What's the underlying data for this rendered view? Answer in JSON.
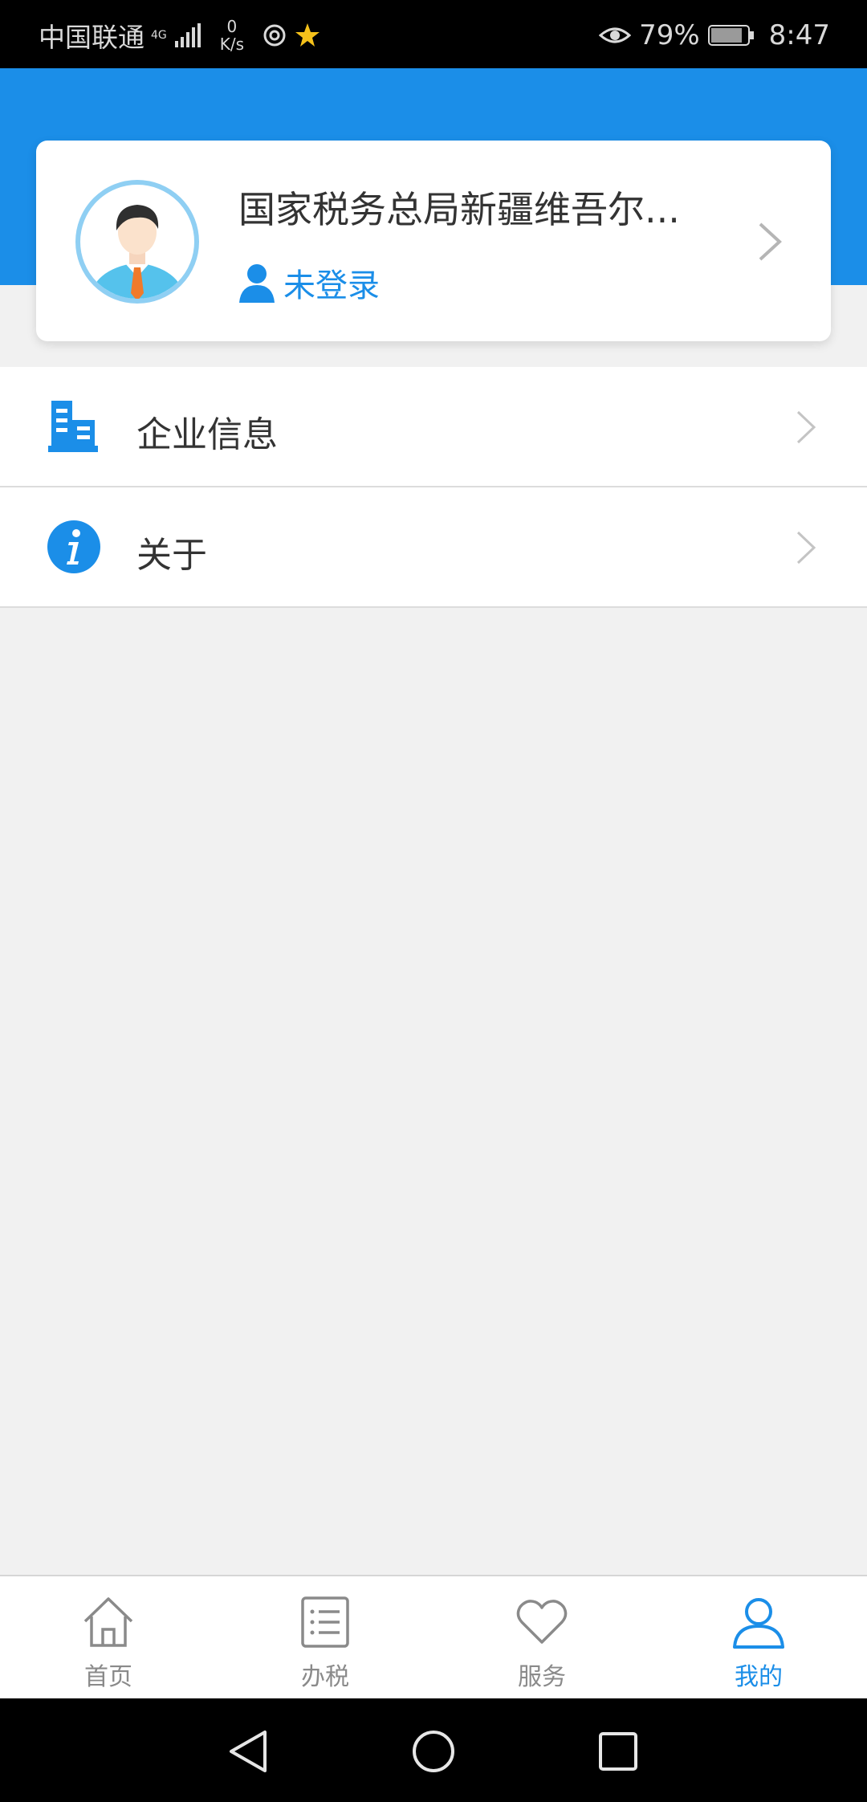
{
  "status_bar": {
    "carrier": "中国联通",
    "network_type": "4G",
    "net_speed_value": "0",
    "net_speed_unit": "K/s",
    "battery_percent": "79%",
    "time": "8:47"
  },
  "profile": {
    "org_name": "国家税务总局新疆维吾尔...",
    "login_status": "未登录"
  },
  "menu": [
    {
      "label": "企业信息",
      "icon": "building-icon"
    },
    {
      "label": "关于",
      "icon": "info-icon"
    }
  ],
  "tabs": [
    {
      "label": "首页",
      "icon": "home-icon",
      "active": false
    },
    {
      "label": "办税",
      "icon": "list-icon",
      "active": false
    },
    {
      "label": "服务",
      "icon": "heart-icon",
      "active": false
    },
    {
      "label": "我的",
      "icon": "user-icon",
      "active": true
    }
  ],
  "colors": {
    "accent": "#1b8ee8",
    "background": "#f1f1f1",
    "tab_inactive": "#8a8a8a"
  }
}
